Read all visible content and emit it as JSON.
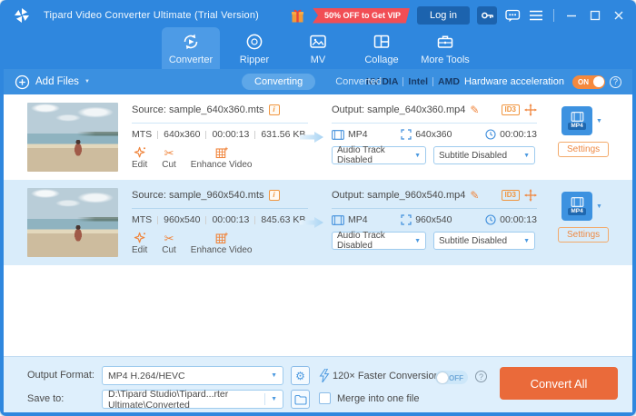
{
  "titlebar": {
    "title": "Tipard Video Converter Ultimate (Trial Version)",
    "promo": "50% OFF to Get VIP",
    "login": "Log in"
  },
  "tabs": {
    "converter": "Converter",
    "ripper": "Ripper",
    "mv": "MV",
    "collage": "Collage",
    "more_tools": "More Tools"
  },
  "toolbar": {
    "add_files": "Add Files",
    "converting": "Converting",
    "converted": "Converted",
    "nvidia": "NVIDIA",
    "intel": "Intel",
    "amd": "AMD",
    "hw_accel": "Hardware acceleration",
    "hw_state": "ON"
  },
  "files": [
    {
      "source": "Source: sample_640x360.mts",
      "format": "MTS",
      "resolution": "640x360",
      "duration": "00:00:13",
      "size": "631.56 KB",
      "edit": "Edit",
      "cut": "Cut",
      "enhance": "Enhance Video",
      "output": "Output: sample_640x360.mp4",
      "id3": "ID3",
      "out_format": "MP4",
      "out_resolution": "640x360",
      "out_duration": "00:00:13",
      "audio_track": "Audio Track Disabled",
      "subtitle": "Subtitle Disabled",
      "format_badge": "MP4",
      "settings": "Settings"
    },
    {
      "source": "Source: sample_960x540.mts",
      "format": "MTS",
      "resolution": "960x540",
      "duration": "00:00:13",
      "size": "845.63 KB",
      "edit": "Edit",
      "cut": "Cut",
      "enhance": "Enhance Video",
      "output": "Output: sample_960x540.mp4",
      "id3": "ID3",
      "out_format": "MP4",
      "out_resolution": "960x540",
      "out_duration": "00:00:13",
      "audio_track": "Audio Track Disabled",
      "subtitle": "Subtitle Disabled",
      "format_badge": "MP4",
      "settings": "Settings"
    }
  ],
  "footer": {
    "output_format_label": "Output Format:",
    "output_format_value": "MP4 H.264/HEVC",
    "save_to_label": "Save to:",
    "save_to_value": "D:\\Tipard Studio\\Tipard...rter Ultimate\\Converted",
    "faster": "120× Faster Conversion",
    "faster_state": "OFF",
    "merge": "Merge into one file",
    "convert_all": "Convert All"
  },
  "icons": {
    "caret": "▼",
    "info": "i",
    "scissors": "✂",
    "pencil": "✎",
    "gear": "⚙",
    "question": "?"
  },
  "colors": {
    "titlebar_blue": "#2f87de",
    "toolbar_blue": "#3b90e0",
    "tab_active_blue": "#4d9be6",
    "row_alt_bg": "#d9ecfa",
    "footer_bg": "#deeffc",
    "accent_orange": "#f0853c",
    "convert_button_orange": "#ea6a3a",
    "promo_red": "#f14e55",
    "login_blue": "#1c63ae",
    "link_blue": "#3f8edc",
    "toggle_on_orange": "#f5893d"
  }
}
